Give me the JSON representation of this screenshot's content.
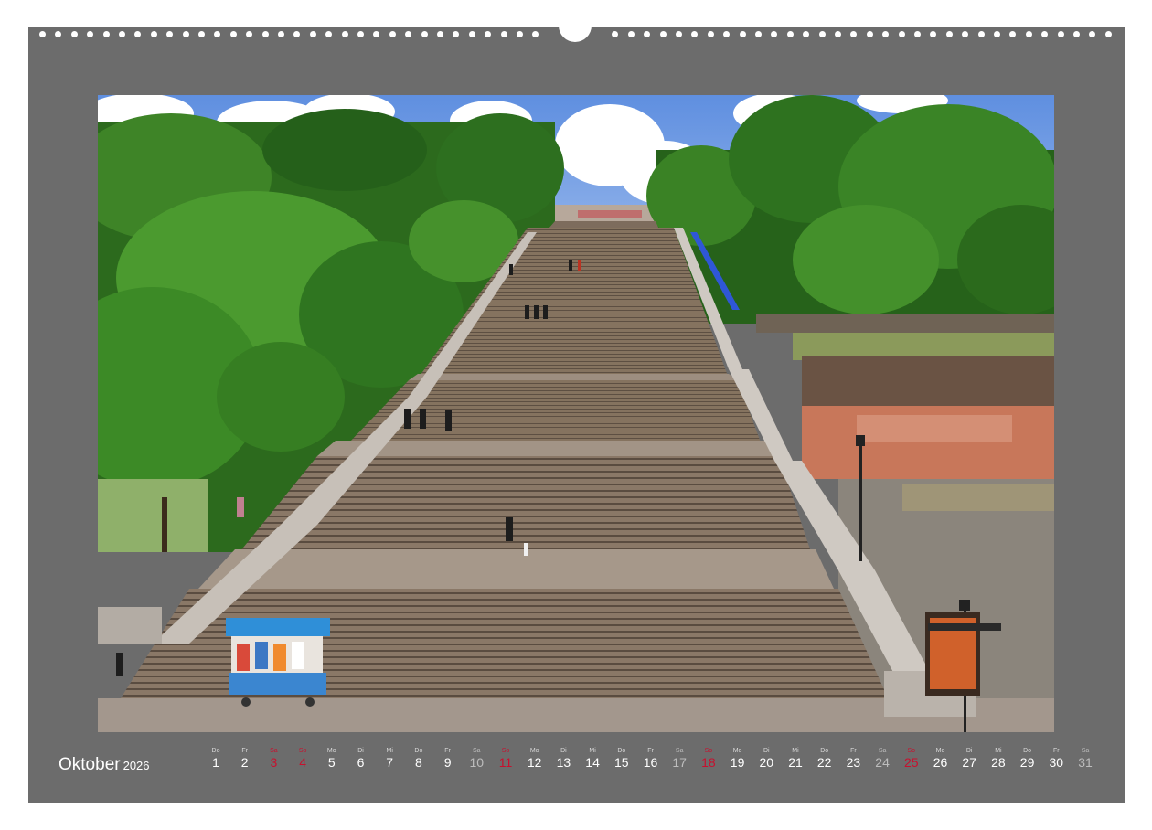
{
  "calendar": {
    "month": "Oktober",
    "year": "2026",
    "days": [
      {
        "n": "1",
        "wd": "Do",
        "kind": "normal"
      },
      {
        "n": "2",
        "wd": "Fr",
        "kind": "normal"
      },
      {
        "n": "3",
        "wd": "Sa",
        "kind": "holiday"
      },
      {
        "n": "4",
        "wd": "So",
        "kind": "holiday"
      },
      {
        "n": "5",
        "wd": "Mo",
        "kind": "normal"
      },
      {
        "n": "6",
        "wd": "Di",
        "kind": "normal"
      },
      {
        "n": "7",
        "wd": "Mi",
        "kind": "normal"
      },
      {
        "n": "8",
        "wd": "Do",
        "kind": "normal"
      },
      {
        "n": "9",
        "wd": "Fr",
        "kind": "normal"
      },
      {
        "n": "10",
        "wd": "Sa",
        "kind": "weekend"
      },
      {
        "n": "11",
        "wd": "So",
        "kind": "holiday"
      },
      {
        "n": "12",
        "wd": "Mo",
        "kind": "normal"
      },
      {
        "n": "13",
        "wd": "Di",
        "kind": "normal"
      },
      {
        "n": "14",
        "wd": "Mi",
        "kind": "normal"
      },
      {
        "n": "15",
        "wd": "Do",
        "kind": "normal"
      },
      {
        "n": "16",
        "wd": "Fr",
        "kind": "normal"
      },
      {
        "n": "17",
        "wd": "Sa",
        "kind": "weekend"
      },
      {
        "n": "18",
        "wd": "So",
        "kind": "holiday"
      },
      {
        "n": "19",
        "wd": "Mo",
        "kind": "normal"
      },
      {
        "n": "20",
        "wd": "Di",
        "kind": "normal"
      },
      {
        "n": "21",
        "wd": "Mi",
        "kind": "normal"
      },
      {
        "n": "22",
        "wd": "Do",
        "kind": "normal"
      },
      {
        "n": "23",
        "wd": "Fr",
        "kind": "normal"
      },
      {
        "n": "24",
        "wd": "Sa",
        "kind": "weekend"
      },
      {
        "n": "25",
        "wd": "So",
        "kind": "holiday"
      },
      {
        "n": "26",
        "wd": "Mo",
        "kind": "normal"
      },
      {
        "n": "27",
        "wd": "Di",
        "kind": "normal"
      },
      {
        "n": "28",
        "wd": "Mi",
        "kind": "normal"
      },
      {
        "n": "29",
        "wd": "Do",
        "kind": "normal"
      },
      {
        "n": "30",
        "wd": "Fr",
        "kind": "normal"
      },
      {
        "n": "31",
        "wd": "Sa",
        "kind": "weekend"
      }
    ]
  },
  "photo": {
    "sign_text": "◄ ►"
  },
  "colors": {
    "sheet": "#6c6c6c",
    "holiday": "#c8102e",
    "sky": "#7aa6e8",
    "foliage": "#2f6e1e",
    "stone": "#8a7866"
  }
}
